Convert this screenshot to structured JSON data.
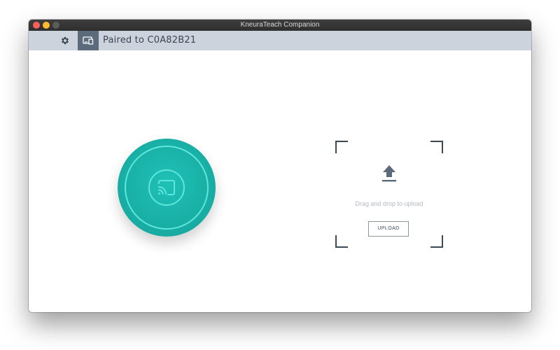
{
  "window": {
    "title": "KneuraTeach Companion",
    "controls": [
      "close",
      "minimize",
      "maximize"
    ]
  },
  "toolbar": {
    "settings_icon": "gear-icon",
    "device_icon": "devices-icon",
    "paired_label": "Paired to C0A82B21"
  },
  "cast": {
    "icon": "cast-icon",
    "accent_color": "#17aaa1",
    "ring_color": "#5fe6dd"
  },
  "upload": {
    "icon": "upload-arrow-icon",
    "drop_text": "Drag and drop to upload",
    "button_label": "UPLOAD"
  },
  "colors": {
    "toolbar_bg": "#cdd3dc",
    "active_button_bg": "#5b6b7c",
    "text_dark": "#3a4654"
  }
}
